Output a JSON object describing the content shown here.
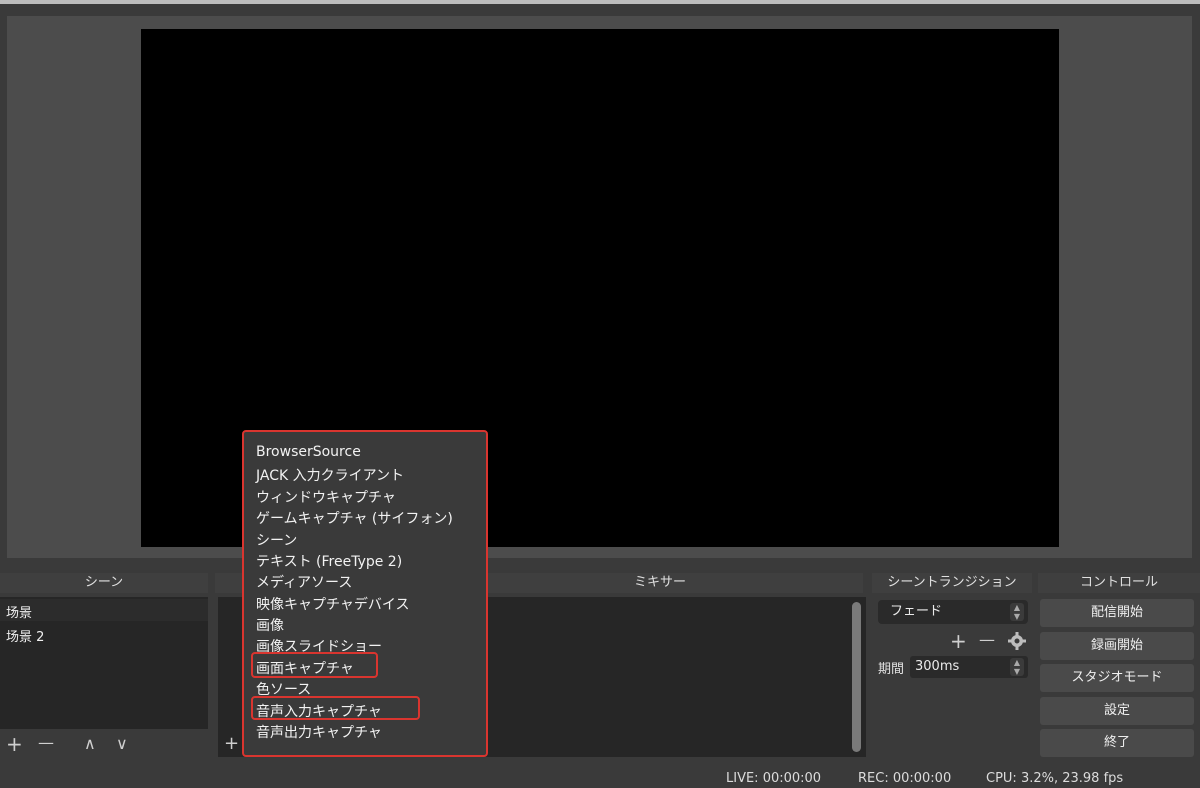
{
  "preview": {},
  "docks": {
    "scenes": {
      "title": "シーン",
      "items": [
        "场景",
        "场景 2"
      ]
    },
    "mixer": {
      "title": "ミキサー"
    },
    "transitions": {
      "title": "シーントランジション",
      "selected": "フェード",
      "duration_label": "期間",
      "duration_value": "300ms"
    },
    "controls": {
      "title": "コントロール",
      "buttons": [
        "配信開始",
        "録画開始",
        "スタジオモード",
        "設定",
        "終了"
      ]
    }
  },
  "toolbar": {
    "add": "+",
    "remove": "—",
    "up": "∧",
    "down": "∨"
  },
  "add_source_menu": {
    "items": [
      "BrowserSource",
      "JACK 入力クライアント",
      "ウィンドウキャプチャ",
      "ゲームキャプチャ (サイフォン)",
      "シーン",
      "テキスト (FreeType 2)",
      "メディアソース",
      "映像キャプチャデバイス",
      "画像",
      "画像スライドショー",
      "画面キャプチャ",
      "色ソース",
      "音声入力キャプチャ",
      "音声出力キャプチャ"
    ]
  },
  "status_bar": {
    "live": "LIVE: 00:00:00",
    "rec": "REC: 00:00:00",
    "cpu": "CPU: 3.2%, 23.98 fps"
  },
  "colors": {
    "highlight": "#d9352f",
    "background": "#3a3a3a",
    "preview": "#000000"
  }
}
